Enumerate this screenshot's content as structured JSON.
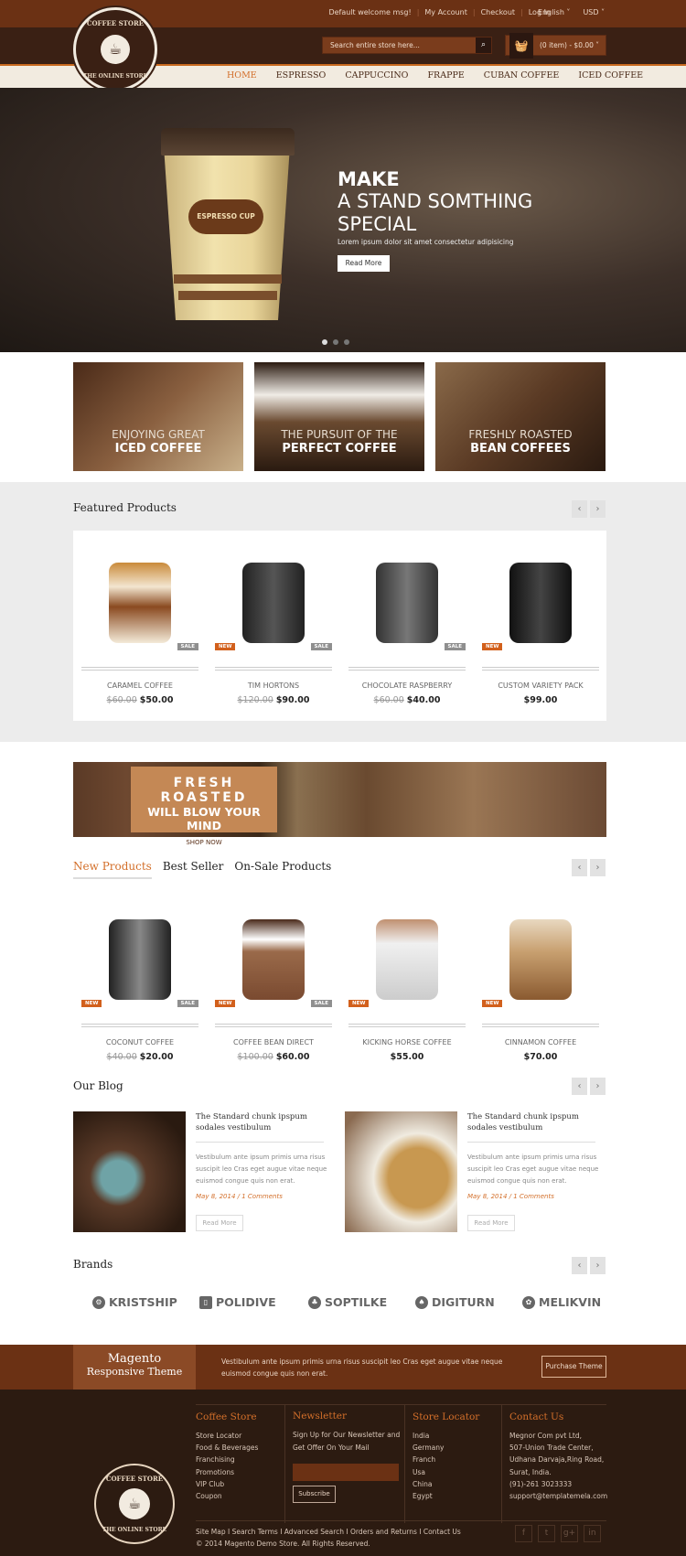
{
  "header": {
    "welcome": "Default welcome msg!",
    "links": [
      "My Account",
      "Checkout",
      "Log In"
    ],
    "language": "English",
    "currency": "USD",
    "search_placeholder": "Search entire store here...",
    "cart": "(0 item) - $0.00",
    "logo_top": "COFFEE STORE",
    "logo_bottom": "THE ONLINE STORE"
  },
  "nav": [
    "HOME",
    "ESPRESSO",
    "CAPPUCCINO",
    "FRAPPE",
    "CUBAN COFFEE",
    "ICED COFFEE"
  ],
  "hero": {
    "cup_label": "ESPRESSO CUP",
    "line1": "MAKE",
    "line2": "A STAND SOMTHING SPECIAL",
    "sub": "Lorem ipsum dolor sit amet consectetur adipisicing",
    "button": "Read More",
    "slides": 3,
    "active_slide": 1
  },
  "promos": [
    {
      "a": "ENJOYING GREAT",
      "b": "ICED COFFEE"
    },
    {
      "a": "THE PURSUIT OF THE",
      "b": "PERFECT COFFEE"
    },
    {
      "a": "FRESHLY ROASTED",
      "b": "BEAN COFFEES"
    }
  ],
  "featured": {
    "title": "Featured Products",
    "products": [
      {
        "name": "CARAMEL COFFEE",
        "old": "$60.00",
        "price": "$50.00",
        "new": "",
        "sale": "SALE"
      },
      {
        "name": "TIM HORTONS",
        "old": "$120.00",
        "price": "$90.00",
        "new": "NEW",
        "sale": "SALE"
      },
      {
        "name": "CHOCOLATE RASPBERRY",
        "old": "$60.00",
        "price": "$40.00",
        "new": "",
        "sale": "SALE"
      },
      {
        "name": "CUSTOM VARIETY PACK",
        "old": "",
        "price": "$99.00",
        "new": "NEW",
        "sale": ""
      }
    ]
  },
  "banner": {
    "l1": "FRESH ROASTED",
    "l2": "WILL BLOW YOUR MIND",
    "l3": "SHOP NOW"
  },
  "tabs": [
    "New Products",
    "Best Seller",
    "On-Sale Products"
  ],
  "new_products": [
    {
      "name": "COCONUT COFFEE",
      "old": "$40.00",
      "price": "$20.00",
      "new": "NEW",
      "sale": "SALE"
    },
    {
      "name": "COFFEE BEAN DIRECT",
      "old": "$100.00",
      "price": "$60.00",
      "new": "NEW",
      "sale": "SALE"
    },
    {
      "name": "KICKING HORSE COFFEE",
      "old": "",
      "price": "$55.00",
      "new": "NEW",
      "sale": ""
    },
    {
      "name": "CINNAMON COFFEE",
      "old": "",
      "price": "$70.00",
      "new": "NEW",
      "sale": ""
    }
  ],
  "blog": {
    "title": "Our Blog",
    "posts": [
      {
        "title": "The Standard chunk ipspum sodales vestibulum",
        "excerpt": "Vestibulum ante ipsum primis urna risus suscipit leo Cras eget augue vitae neque euismod congue quis non erat.",
        "date": "May 8, 2014 / 1 Comments",
        "button": "Read More"
      },
      {
        "title": "The Standard chunk ipspum sodales vestibulum",
        "excerpt": "Vestibulum ante ipsum primis urna risus suscipit leo Cras eget augue vitae neque euismod congue quis non erat.",
        "date": "May 8, 2014 / 1 Comments",
        "button": "Read More"
      }
    ]
  },
  "brands": {
    "title": "Brands",
    "items": [
      "KRISTSHIP",
      "POLIDIVE",
      "SOPTILKE",
      "DIGITURN",
      "MELIKVIN"
    ]
  },
  "strip": {
    "t1": "Magento",
    "t2": "Responsive Theme",
    "text": "Vestibulum ante ipsum primis urna risus suscipit leo Cras eget augue vitae neque euismod congue quis non erat.",
    "button": "Purchase Theme"
  },
  "footer": {
    "col1": {
      "title": "Coffee Store",
      "items": [
        "Store Locator",
        "Food & Beverages",
        "Franchising",
        "Promotions",
        "VIP Club",
        "Coupon"
      ]
    },
    "col2": {
      "title": "Newsletter",
      "text": "Sign Up for Our Newsletter and Get Offer On Your Mail",
      "button": "Subscribe"
    },
    "col3": {
      "title": "Store Locator",
      "items": [
        "India",
        "Germany",
        "Franch",
        "Usa",
        "China",
        "Egypt"
      ]
    },
    "col4": {
      "title": "Contact Us",
      "items": [
        "Megnor Com pvt Ltd,",
        "507-Union Trade Center,",
        "Udhana Darvaja,Ring Road,",
        "Surat, India.",
        "(91)-261 3023333",
        "support@templatemela.com"
      ]
    },
    "links": "Site Map I Search Terms I Advanced Search I Orders and Returns I Contact Us",
    "copyright": "© 2014 Magento Demo Store. All Rights Reserved.",
    "social": [
      "f",
      "t",
      "g+",
      "in"
    ]
  },
  "colors": {
    "accent": "#d36f2a",
    "brown": "#6b3114",
    "dark": "#2c1b11"
  }
}
